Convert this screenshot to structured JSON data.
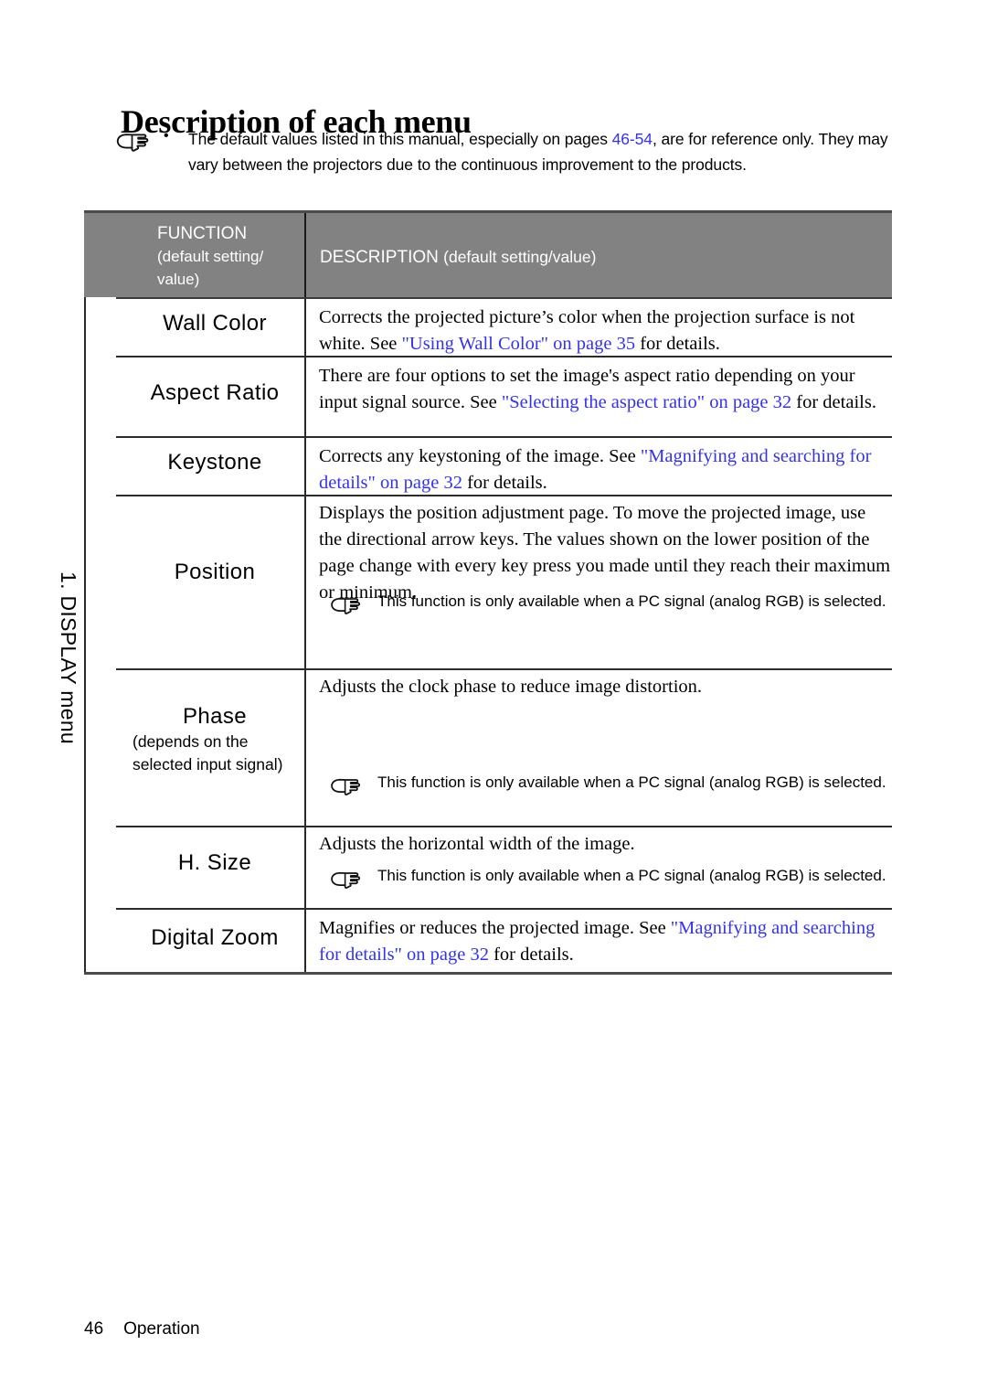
{
  "page": {
    "title": "Description of each menu",
    "footer": {
      "page_number": "46",
      "section": "Operation"
    }
  },
  "top_note": {
    "icon": "pointing-hand-icon",
    "bullet": "•",
    "text_before": "The default values listed in this manual, especially on pages ",
    "link": "46-54",
    "text_after": ", are for reference only. They may vary between the projectors due to the continuous improvement to the products."
  },
  "table": {
    "side_label": "1. DISPLAY menu",
    "header": {
      "function_title": "FUNCTION",
      "function_sub": "(default setting/ value)",
      "description_title": "DESCRIPTION",
      "description_sub": "(default setting/value)"
    },
    "rows": [
      {
        "function": "Wall Color",
        "function_sub": "",
        "paragraphs": [
          {
            "segments": [
              {
                "text": "Corrects the projected picture’s color when the projection surface is not white. See ",
                "link": false
              },
              {
                "text": "\"Using Wall Color\" on page 35",
                "link": true
              },
              {
                "text": " for details.",
                "link": false
              }
            ]
          }
        ],
        "note": null
      },
      {
        "function": "Aspect Ratio",
        "function_sub": "",
        "paragraphs": [
          {
            "segments": [
              {
                "text": "There are four options to set the image's aspect ratio depending on your input signal source. See ",
                "link": false
              },
              {
                "text": "\"Selecting the aspect ratio\" on page 32",
                "link": true
              },
              {
                "text": " for details.",
                "link": false
              }
            ]
          }
        ],
        "note": null
      },
      {
        "function": "Keystone",
        "function_sub": "",
        "paragraphs": [
          {
            "segments": [
              {
                "text": "Corrects any keystoning of the image. See ",
                "link": false
              },
              {
                "text": "\"Magnifying and searching for details\" on page 32",
                "link": true
              },
              {
                "text": " for details.",
                "link": false
              }
            ]
          }
        ],
        "note": null
      },
      {
        "function": "Position",
        "function_sub": "",
        "paragraphs": [
          {
            "segments": [
              {
                "text": "Displays the position adjustment page. To move the projected image, use the directional arrow keys. The values shown on the lower position of the page change with every key press you made until they reach their maximum or minimum.",
                "link": false
              }
            ]
          }
        ],
        "note": {
          "icon": "pointing-hand-icon",
          "text": "This function is only available when a PC signal (analog RGB) is selected."
        }
      },
      {
        "function": "Phase",
        "function_sub": "(depends on the selected input signal)",
        "paragraphs": [
          {
            "segments": [
              {
                "text": "Adjusts the clock phase to reduce image distortion.",
                "link": false
              }
            ]
          }
        ],
        "note": {
          "icon": "pointing-hand-icon",
          "text": "This function is only available when a PC signal (analog RGB) is selected."
        }
      },
      {
        "function": "H. Size",
        "function_sub": "",
        "paragraphs": [
          {
            "segments": [
              {
                "text": "Adjusts the horizontal width of the image.",
                "link": false
              }
            ]
          }
        ],
        "note": {
          "icon": "pointing-hand-icon",
          "text": "This function is only available when a PC signal (analog RGB) is selected."
        }
      },
      {
        "function": "Digital Zoom",
        "function_sub": "",
        "paragraphs": [
          {
            "segments": [
              {
                "text": "Magnifies or reduces the projected image. See ",
                "link": false
              },
              {
                "text": "\"Magnifying and searching for details\" on page 32",
                "link": true
              },
              {
                "text": " for details.",
                "link": false
              }
            ]
          }
        ],
        "note": null
      }
    ]
  },
  "colors": {
    "link": "#3333ee",
    "header_background": "#828282",
    "header_text": "#ffffff",
    "rule": "#2b2b2b"
  }
}
